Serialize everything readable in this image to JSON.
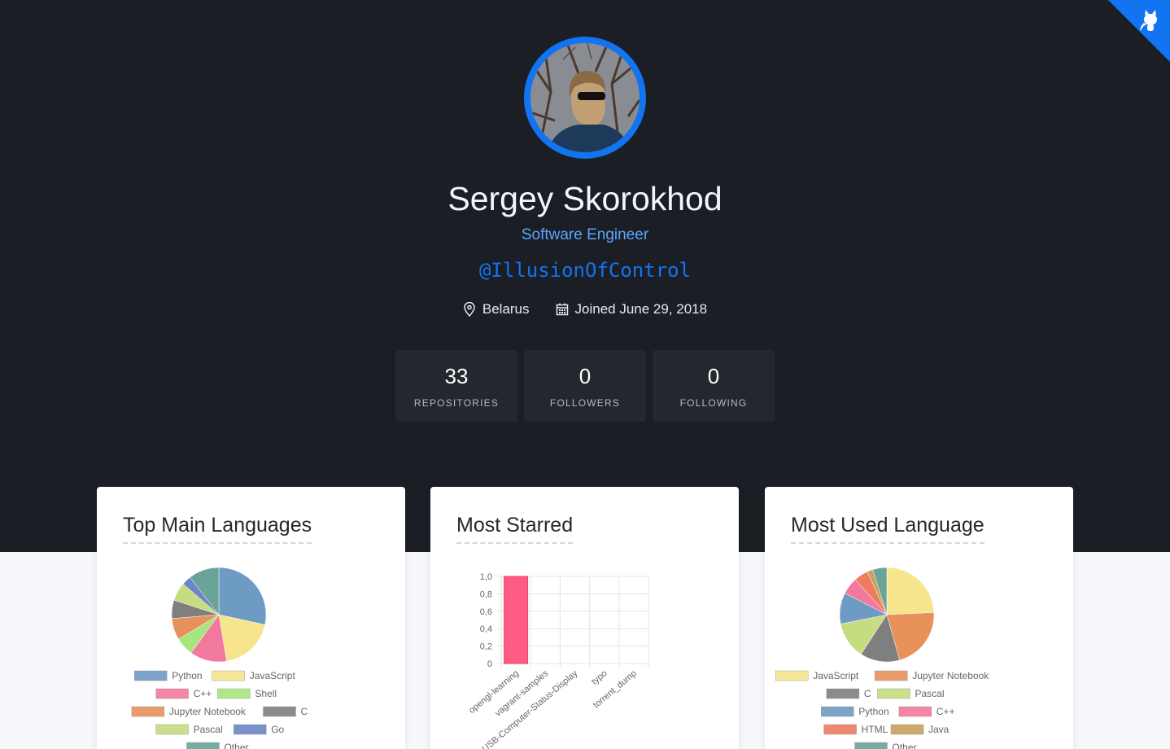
{
  "profile": {
    "name": "Sergey Skorokhod",
    "role": "Software Engineer",
    "handle": "@IllusionOfControl",
    "location": "Belarus",
    "joined": "Joined June 29, 2018",
    "location_icon": "map-pin-icon",
    "calendar_icon": "calendar-icon"
  },
  "stats": [
    {
      "value": "33",
      "label": "REPOSITORIES"
    },
    {
      "value": "0",
      "label": "FOLLOWERS"
    },
    {
      "value": "0",
      "label": "FOLLOWING"
    }
  ],
  "colors": {
    "accent": "#1274f1",
    "link": "#58a6ff",
    "hero_bg": "#1b1e24",
    "stat_bg": "#24272e"
  },
  "cards": {
    "languages_title": "Top Main Languages",
    "starred_title": "Most Starred",
    "used_title": "Most Used Language"
  },
  "chart_data": [
    {
      "type": "pie",
      "title": "Top Main Languages",
      "categories": [
        "Python",
        "JavaScript",
        "C++",
        "Shell",
        "Jupyter Notebook",
        "C",
        "Pascal",
        "Go",
        "Other"
      ],
      "values": [
        27,
        18,
        12,
        6,
        7,
        6,
        6,
        3,
        10
      ],
      "colors": [
        "#6d9bc3",
        "#f6e58d",
        "#f3799c",
        "#a9e57e",
        "#e8915a",
        "#7f7f7f",
        "#c5dc80",
        "#6c85c6",
        "#6aa398"
      ],
      "legend": "bottom"
    },
    {
      "type": "bar",
      "title": "Most Starred",
      "categories": [
        "opengl-learning",
        "vagrant-samples",
        "USB-Computer-Status-Display",
        "typo",
        "torrent_dump"
      ],
      "values": [
        1,
        0,
        0,
        0,
        0
      ],
      "ylim": [
        0,
        1
      ],
      "yticks": [
        "0",
        "0,2",
        "0,4",
        "0,6",
        "0,8",
        "1,0"
      ],
      "color": "#ff5c85",
      "grid": true
    },
    {
      "type": "pie",
      "title": "Most Used Language",
      "categories": [
        "JavaScript",
        "Jupyter Notebook",
        "C",
        "Pascal",
        "Python",
        "C++",
        "HTML",
        "Java",
        "Other"
      ],
      "values": [
        25,
        22,
        14,
        13,
        11,
        6,
        5,
        2,
        5
      ],
      "colors": [
        "#f6e58d",
        "#e8915a",
        "#7f7f7f",
        "#c5dc80",
        "#6d9bc3",
        "#f3799c",
        "#ee7d5f",
        "#c9a05d",
        "#6aa398"
      ],
      "legend": "bottom"
    }
  ]
}
